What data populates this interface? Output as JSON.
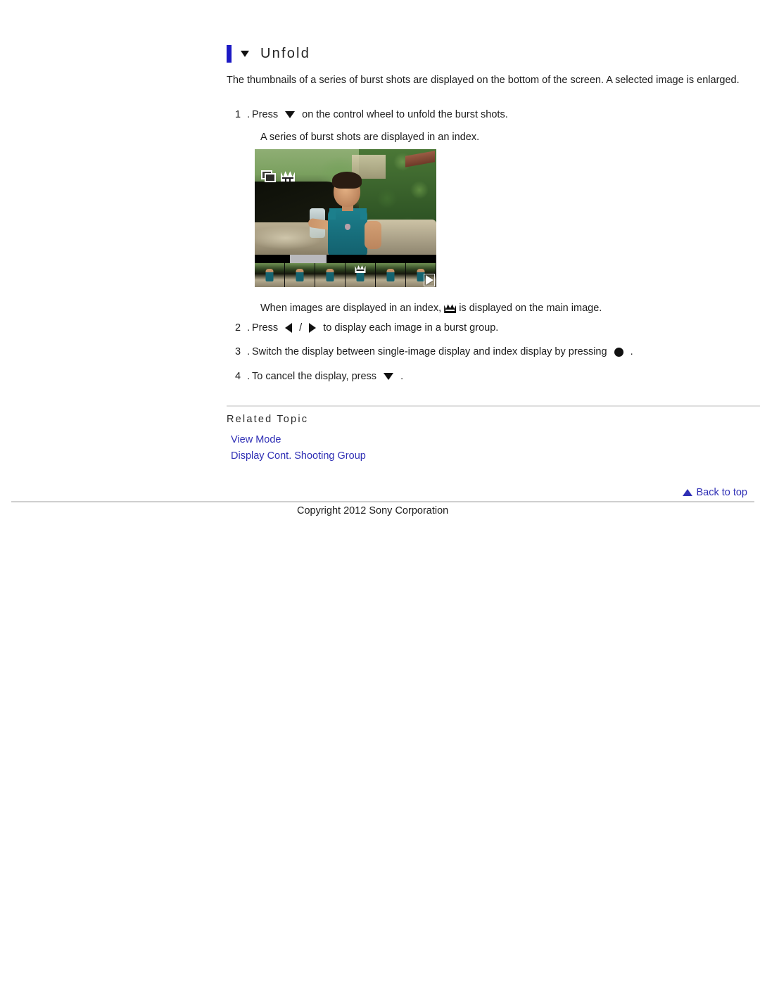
{
  "heading": {
    "title": "Unfold",
    "marker_icon": "triangle-down-icon"
  },
  "intro": "The thumbnails of a series of burst shots are displayed on the bottom of the screen. A selected image is enlarged.",
  "steps": [
    {
      "number": "1 .",
      "before": "Press",
      "icon": "triangle-down-icon",
      "after": "on the control wheel to unfold the burst shots.",
      "sub": "A series of burst shots are displayed in an index."
    },
    {
      "number": "2 .",
      "before": "Press",
      "icon": "triangle-left-icon",
      "separator": "/",
      "icon2": "triangle-right-icon",
      "after": "to display each image in a burst group."
    },
    {
      "number": "3 .",
      "before": "Switch the display between single-image display and index display by pressing",
      "icon": "center-button-dot-icon",
      "after": "."
    },
    {
      "number": "4 .",
      "before": "To cancel the display, press",
      "icon": "triangle-down-icon",
      "after": "."
    }
  ],
  "note": {
    "before": "When images are displayed in an index,",
    "icon": "crown-icon",
    "after": "is displayed on the main image."
  },
  "camera_screen": {
    "overlay_icons": [
      "burst-stack-icon",
      "crown-icon"
    ],
    "thumbnail_count": 6,
    "selected_thumbnail_index": 3,
    "selected_marker_icon": "crown-icon",
    "next_indicator_icon": "play-triangle-icon",
    "alt": "Camera playback screen showing an enlarged burst shot of a child with a filmstrip index of burst thumbnails at the bottom"
  },
  "related": {
    "title": "Related Topic",
    "links": [
      {
        "label": "View Mode"
      },
      {
        "label": "Display Cont. Shooting Group"
      }
    ]
  },
  "footer": {
    "back_to_top": "Back to top",
    "back_to_top_icon": "triangle-up-icon",
    "copyright": "Copyright 2012 Sony Corporation"
  },
  "colors": {
    "heading_bar": "#1c19c4",
    "link": "#2f2fb5",
    "text": "#1c1c1c",
    "divider": "#dedede",
    "footer_rule": "#cfcfcf"
  }
}
